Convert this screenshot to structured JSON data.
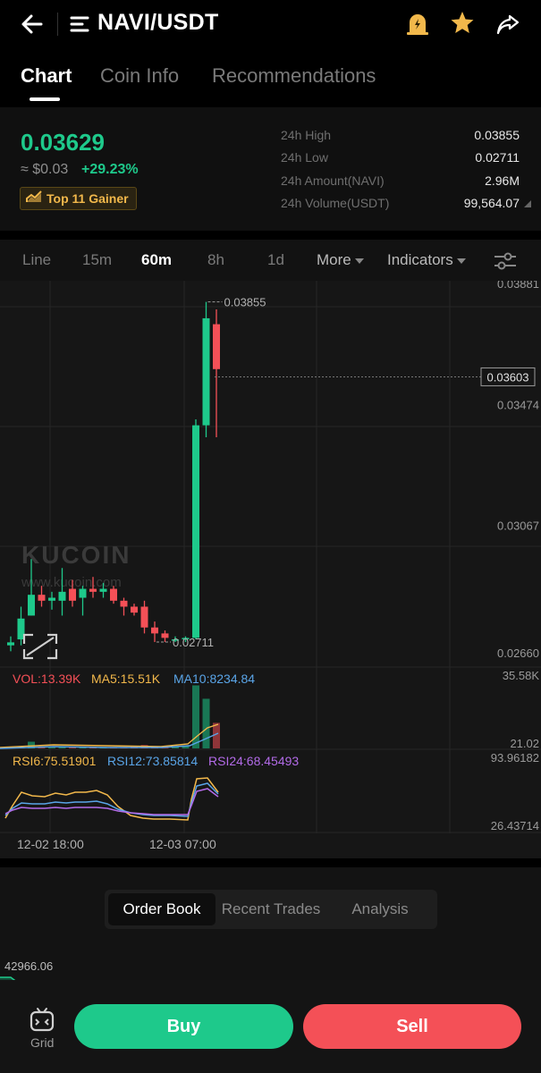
{
  "header": {
    "back_icon": "arrow-left-icon",
    "menu_icon": "menu-icon",
    "pair": "NAVI/USDT",
    "alert_icon": "price-alert-icon",
    "favorite_icon": "star-icon",
    "share_icon": "share-icon"
  },
  "tabs": [
    {
      "label": "Chart",
      "active": true
    },
    {
      "label": "Coin Info",
      "active": false
    },
    {
      "label": "Recommendations",
      "active": false
    }
  ],
  "summary": {
    "last_price": "0.03629",
    "usd_price": "≈ $0.03",
    "change": "+29.23%",
    "badge": "Top 11 Gainer",
    "stats": [
      {
        "label": "24h High",
        "value": "0.03855"
      },
      {
        "label": "24h Low",
        "value": "0.02711"
      },
      {
        "label": "24h Amount(NAVI)",
        "value": "2.96M"
      },
      {
        "label": "24h Volume(USDT)",
        "value": "99,564.07"
      }
    ]
  },
  "timeframes": {
    "items": [
      "Line",
      "15m",
      "60m",
      "8h",
      "1d"
    ],
    "active": "60m",
    "more": "More",
    "indicators": "Indicators",
    "settings_icon": "chart-settings-icon"
  },
  "chart_data": {
    "type": "candlestick",
    "price_axis": [
      "0.03881",
      "0.03474",
      "0.03067",
      "0.02660"
    ],
    "current_price_tag": "0.03603",
    "high_marker": "0.03855",
    "low_marker": "0.02711",
    "watermark": "KUCOIN",
    "watermark_url": "www.kucoin.com",
    "ylim": [
      0.0266,
      0.03881
    ],
    "candles": [
      {
        "o": 0.027,
        "h": 0.0273,
        "l": 0.0268,
        "c": 0.0271
      },
      {
        "o": 0.0272,
        "h": 0.0283,
        "l": 0.027,
        "c": 0.0279
      },
      {
        "o": 0.028,
        "h": 0.0299,
        "l": 0.028,
        "c": 0.0287
      },
      {
        "o": 0.0287,
        "h": 0.029,
        "l": 0.0283,
        "c": 0.0285
      },
      {
        "o": 0.0285,
        "h": 0.0288,
        "l": 0.0282,
        "c": 0.0286
      },
      {
        "o": 0.0285,
        "h": 0.0296,
        "l": 0.028,
        "c": 0.0288
      },
      {
        "o": 0.0289,
        "h": 0.0292,
        "l": 0.0283,
        "c": 0.0285
      },
      {
        "o": 0.0286,
        "h": 0.029,
        "l": 0.028,
        "c": 0.0289
      },
      {
        "o": 0.0289,
        "h": 0.0293,
        "l": 0.0286,
        "c": 0.0288
      },
      {
        "o": 0.0288,
        "h": 0.0291,
        "l": 0.0286,
        "c": 0.0289
      },
      {
        "o": 0.0289,
        "h": 0.029,
        "l": 0.0284,
        "c": 0.0285
      },
      {
        "o": 0.0285,
        "h": 0.0286,
        "l": 0.028,
        "c": 0.0283
      },
      {
        "o": 0.0283,
        "h": 0.0284,
        "l": 0.028,
        "c": 0.0281
      },
      {
        "o": 0.0283,
        "h": 0.0285,
        "l": 0.0274,
        "c": 0.0276
      },
      {
        "o": 0.0276,
        "h": 0.0278,
        "l": 0.02711,
        "c": 0.0274
      },
      {
        "o": 0.0274,
        "h": 0.0275,
        "l": 0.02711,
        "c": 0.02725
      },
      {
        "o": 0.0272,
        "h": 0.0273,
        "l": 0.02711,
        "c": 0.0272
      },
      {
        "o": 0.0272,
        "h": 0.0273,
        "l": 0.02711,
        "c": 0.02725
      },
      {
        "o": 0.02725,
        "h": 0.0346,
        "l": 0.0272,
        "c": 0.0344
      },
      {
        "o": 0.0344,
        "h": 0.03855,
        "l": 0.034,
        "c": 0.038
      },
      {
        "o": 0.0378,
        "h": 0.0383,
        "l": 0.034,
        "c": 0.03629
      }
    ],
    "x_labels": [
      "12-02 18:00",
      "12-03 07:00"
    ],
    "volume": {
      "labels": {
        "vol": "VOL:13.39K",
        "ma5": "MA5:15.51K",
        "ma10": "MA10:8234.84"
      },
      "axis": [
        "35.58K",
        "21.02"
      ],
      "values": [
        0.4,
        0.5,
        3.5,
        0.6,
        0.5,
        1.2,
        0.6,
        0.8,
        0.6,
        0.5,
        0.7,
        0.6,
        1.0,
        1.8,
        0.8,
        0.5,
        0.9,
        1.5,
        33.0,
        26.0,
        13.39
      ]
    },
    "rsi": {
      "labels": {
        "rsi6": "RSI6:75.51901",
        "rsi12": "RSI12:73.85814",
        "rsi24": "RSI24:68.45493"
      },
      "axis": [
        "93.96182",
        "26.43714"
      ]
    }
  },
  "lower": {
    "tabs": [
      "Order Book",
      "Recent Trades",
      "Analysis"
    ],
    "active": "Order Book",
    "top_value": "42966.06"
  },
  "bottom": {
    "grid_icon": "grid-bot-icon",
    "grid_label": "Grid",
    "buy": "Buy",
    "sell": "Sell"
  },
  "colors": {
    "up": "#1ec98b",
    "down": "#f45057",
    "badge": "#f2b84b",
    "rsi6": "#f2b84b",
    "rsi12": "#5aa5e8",
    "rsi24": "#b36be8"
  }
}
